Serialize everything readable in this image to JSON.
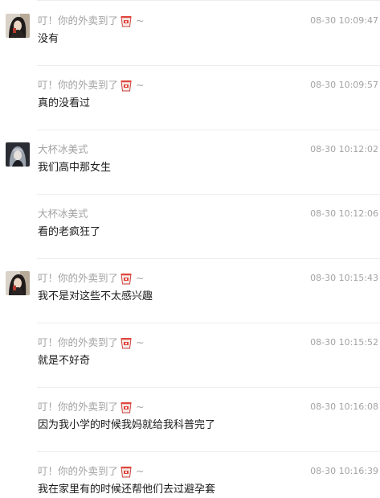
{
  "messages": [
    {
      "sender": "叮！你的外卖到了",
      "suffix": "~",
      "avatar": "dark-hair-avatar",
      "time": "08-30 10:09:47",
      "text": "没有",
      "show_avatar": true
    },
    {
      "sender": "叮！你的外卖到了",
      "suffix": "~",
      "avatar": "dark-hair-avatar",
      "time": "08-30 10:09:57",
      "text": "真的没看过",
      "show_avatar": false
    },
    {
      "sender": "大杯冰美式",
      "suffix": "",
      "avatar": "silver-hair-avatar",
      "time": "08-30 10:12:02",
      "text": "我们高中那女生",
      "show_avatar": true
    },
    {
      "sender": "大杯冰美式",
      "suffix": "",
      "avatar": "silver-hair-avatar",
      "time": "08-30 10:12:06",
      "text": "看的老疯狂了",
      "show_avatar": false
    },
    {
      "sender": "叮！你的外卖到了",
      "suffix": "~",
      "avatar": "dark-hair-avatar",
      "time": "08-30 10:15:43",
      "text": "我不是对这些不太感兴趣",
      "show_avatar": true
    },
    {
      "sender": "叮！你的外卖到了",
      "suffix": "~",
      "avatar": "dark-hair-avatar",
      "time": "08-30 10:15:52",
      "text": "就是不好奇",
      "show_avatar": false
    },
    {
      "sender": "叮！你的外卖到了",
      "suffix": "~",
      "avatar": "dark-hair-avatar",
      "time": "08-30 10:16:08",
      "text": "因为我小学的时候我妈就给我科普完了",
      "show_avatar": false
    },
    {
      "sender": "叮！你的外卖到了",
      "suffix": "~",
      "avatar": "dark-hair-avatar",
      "time": "08-30 10:16:39",
      "text": "我在家里有的时候还帮他们去过避孕套",
      "show_avatar": false
    }
  ],
  "icons": {
    "sender_badge": "takeout-cup-icon"
  },
  "colors": {
    "meta_text": "#a3a3a3",
    "message_text": "#1a1a1a",
    "divider": "#ededed",
    "cup_red": "#e0463c"
  }
}
